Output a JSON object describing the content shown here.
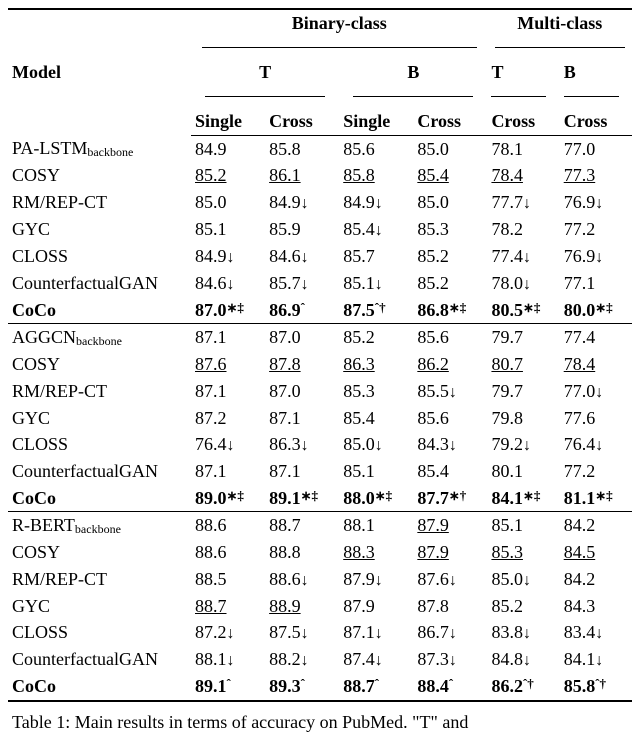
{
  "headers": {
    "model": "Model",
    "bin": "Binary-class",
    "mul": "Multi-class",
    "T": "T",
    "B": "B",
    "single": "Single",
    "cross": "Cross"
  },
  "caption_prefix": "Table 1:",
  "caption_rest": "  Main results in terms of accuracy on PubMed.  \"T\" and",
  "groups": [
    {
      "backbone": {
        "label": "PA-LSTM",
        "sub": "backbone",
        "v": [
          "84.9",
          "85.8",
          "85.6",
          "85.0",
          "78.1",
          "77.0"
        ],
        "flags": [
          "",
          "",
          "",
          "",
          "",
          ""
        ]
      },
      "rows": [
        {
          "label": "COSY",
          "v": [
            "85.2",
            "86.1",
            "85.8",
            "85.4",
            "78.4",
            "77.3"
          ],
          "flags": [
            "u",
            "u",
            "u",
            "u",
            "u",
            "u"
          ]
        },
        {
          "label": "RM/REP-CT",
          "v": [
            "85.0",
            "84.9↓",
            "84.9↓",
            "85.0",
            "77.7↓",
            "76.9↓"
          ],
          "flags": [
            "",
            "",
            "",
            "",
            "",
            ""
          ]
        },
        {
          "label": "GYC",
          "v": [
            "85.1",
            "85.9",
            "85.4↓",
            "85.3",
            "78.2",
            "77.2"
          ],
          "flags": [
            "",
            "",
            "",
            "",
            "",
            ""
          ]
        },
        {
          "label": "CLOSS",
          "v": [
            "84.9↓",
            "84.6↓",
            "85.7",
            "85.2",
            "77.4↓",
            "76.9↓"
          ],
          "flags": [
            "",
            "",
            "",
            "",
            "",
            ""
          ]
        },
        {
          "label": "CounterfactualGAN",
          "v": [
            "84.6↓",
            "85.7↓",
            "85.1↓",
            "85.2",
            "78.0↓",
            "77.1"
          ],
          "flags": [
            "",
            "",
            "",
            "",
            "",
            ""
          ]
        }
      ],
      "coco": {
        "label": "CoCo",
        "v": [
          "87.0∗‡",
          "86.9ˆ",
          "87.5ˆ†",
          "86.8∗‡",
          "80.5∗‡",
          "80.0∗‡"
        ]
      }
    },
    {
      "backbone": {
        "label": "AGGCN",
        "sub": "backbone",
        "v": [
          "87.1",
          "87.0",
          "85.2",
          "85.6",
          "79.7",
          "77.4"
        ],
        "flags": [
          "",
          "",
          "",
          "",
          "",
          ""
        ]
      },
      "rows": [
        {
          "label": "COSY",
          "v": [
            "87.6",
            "87.8",
            "86.3",
            "86.2",
            "80.7",
            "78.4"
          ],
          "flags": [
            "u",
            "u",
            "u",
            "u",
            "u",
            "u"
          ]
        },
        {
          "label": "RM/REP-CT",
          "v": [
            "87.1",
            "87.0",
            "85.3",
            "85.5↓",
            "79.7",
            "77.0↓"
          ],
          "flags": [
            "",
            "",
            "",
            "",
            "",
            ""
          ]
        },
        {
          "label": "GYC",
          "v": [
            "87.2",
            "87.1",
            "85.4",
            "85.6",
            "79.8",
            "77.6"
          ],
          "flags": [
            "",
            "",
            "",
            "",
            "",
            ""
          ]
        },
        {
          "label": "CLOSS",
          "v": [
            "76.4↓",
            "86.3↓",
            "85.0↓",
            "84.3↓",
            "79.2↓",
            "76.4↓"
          ],
          "flags": [
            "",
            "",
            "",
            "",
            "",
            ""
          ]
        },
        {
          "label": "CounterfactualGAN",
          "v": [
            "87.1",
            "87.1",
            "85.1",
            "85.4",
            "80.1",
            "77.2"
          ],
          "flags": [
            "",
            "",
            "",
            "",
            "",
            ""
          ]
        }
      ],
      "coco": {
        "label": "CoCo",
        "v": [
          "89.0∗‡",
          "89.1∗‡",
          "88.0∗‡",
          "87.7∗†",
          "84.1∗‡",
          "81.1∗‡"
        ]
      }
    },
    {
      "backbone": {
        "label": "R-BERT",
        "sub": "backbone",
        "v": [
          "88.6",
          "88.7",
          "88.1",
          "87.9",
          "85.1",
          "84.2"
        ],
        "flags": [
          "",
          "",
          "",
          "u",
          "",
          ""
        ]
      },
      "rows": [
        {
          "label": "COSY",
          "v": [
            "88.6",
            "88.8",
            "88.3",
            "87.9",
            "85.3",
            "84.5"
          ],
          "flags": [
            "",
            "",
            "u",
            "u",
            "u",
            "u"
          ]
        },
        {
          "label": "RM/REP-CT",
          "v": [
            "88.5",
            "88.6↓",
            "87.9↓",
            "87.6↓",
            "85.0↓",
            "84.2"
          ],
          "flags": [
            "",
            "",
            "",
            "",
            "",
            ""
          ]
        },
        {
          "label": "GYC",
          "v": [
            "88.7",
            "88.9",
            "87.9",
            "87.8",
            "85.2",
            "84.3"
          ],
          "flags": [
            "u",
            "u",
            "",
            "",
            "",
            ""
          ]
        },
        {
          "label": "CLOSS",
          "v": [
            "87.2↓",
            "87.5↓",
            "87.1↓",
            "86.7↓",
            "83.8↓",
            "83.4↓"
          ],
          "flags": [
            "",
            "",
            "",
            "",
            "",
            ""
          ]
        },
        {
          "label": "CounterfactualGAN",
          "v": [
            "88.1↓",
            "88.2↓",
            "87.4↓",
            "87.3↓",
            "84.8↓",
            "84.1↓"
          ],
          "flags": [
            "",
            "",
            "",
            "",
            "",
            ""
          ]
        }
      ],
      "coco": {
        "label": "CoCo",
        "v": [
          "89.1ˆ",
          "89.3ˆ",
          "88.7ˆ",
          "88.4ˆ",
          "86.2ˆ†",
          "85.8ˆ†"
        ]
      }
    }
  ],
  "chart_data": {
    "type": "table",
    "title": "Table 1: Main results in terms of accuracy on PubMed.",
    "columns": [
      "Model",
      "Binary T Single",
      "Binary T Cross",
      "Binary B Single",
      "Binary B Cross",
      "Multi T Cross",
      "Multi B Cross"
    ],
    "sections": [
      {
        "backbone": "PA-LSTM",
        "rows": [
          [
            "PA-LSTM_backbone",
            84.9,
            85.8,
            85.6,
            85.0,
            78.1,
            77.0
          ],
          [
            "COSY",
            85.2,
            86.1,
            85.8,
            85.4,
            78.4,
            77.3
          ],
          [
            "RM/REP-CT",
            85.0,
            84.9,
            84.9,
            85.0,
            77.7,
            76.9
          ],
          [
            "GYC",
            85.1,
            85.9,
            85.4,
            85.3,
            78.2,
            77.2
          ],
          [
            "CLOSS",
            84.9,
            84.6,
            85.7,
            85.2,
            77.4,
            76.9
          ],
          [
            "CounterfactualGAN",
            84.6,
            85.7,
            85.1,
            85.2,
            78.0,
            77.1
          ],
          [
            "CoCo",
            87.0,
            86.9,
            87.5,
            86.8,
            80.5,
            80.0
          ]
        ]
      },
      {
        "backbone": "AGGCN",
        "rows": [
          [
            "AGGCN_backbone",
            87.1,
            87.0,
            85.2,
            85.6,
            79.7,
            77.4
          ],
          [
            "COSY",
            87.6,
            87.8,
            86.3,
            86.2,
            80.7,
            78.4
          ],
          [
            "RM/REP-CT",
            87.1,
            87.0,
            85.3,
            85.5,
            79.7,
            77.0
          ],
          [
            "GYC",
            87.2,
            87.1,
            85.4,
            85.6,
            79.8,
            77.6
          ],
          [
            "CLOSS",
            76.4,
            86.3,
            85.0,
            84.3,
            79.2,
            76.4
          ],
          [
            "CounterfactualGAN",
            87.1,
            87.1,
            85.1,
            85.4,
            80.1,
            77.2
          ],
          [
            "CoCo",
            89.0,
            89.1,
            88.0,
            87.7,
            84.1,
            81.1
          ]
        ]
      },
      {
        "backbone": "R-BERT",
        "rows": [
          [
            "R-BERT_backbone",
            88.6,
            88.7,
            88.1,
            87.9,
            85.1,
            84.2
          ],
          [
            "COSY",
            88.6,
            88.8,
            88.3,
            87.9,
            85.3,
            84.5
          ],
          [
            "RM/REP-CT",
            88.5,
            88.6,
            87.9,
            87.6,
            85.0,
            84.2
          ],
          [
            "GYC",
            88.7,
            88.9,
            87.9,
            87.8,
            85.2,
            84.3
          ],
          [
            "CLOSS",
            87.2,
            87.5,
            87.1,
            86.7,
            83.8,
            83.4
          ],
          [
            "CounterfactualGAN",
            88.1,
            88.2,
            87.4,
            87.3,
            84.8,
            84.1
          ],
          [
            "CoCo",
            89.1,
            89.3,
            88.7,
            88.4,
            86.2,
            85.8
          ]
        ]
      }
    ]
  }
}
